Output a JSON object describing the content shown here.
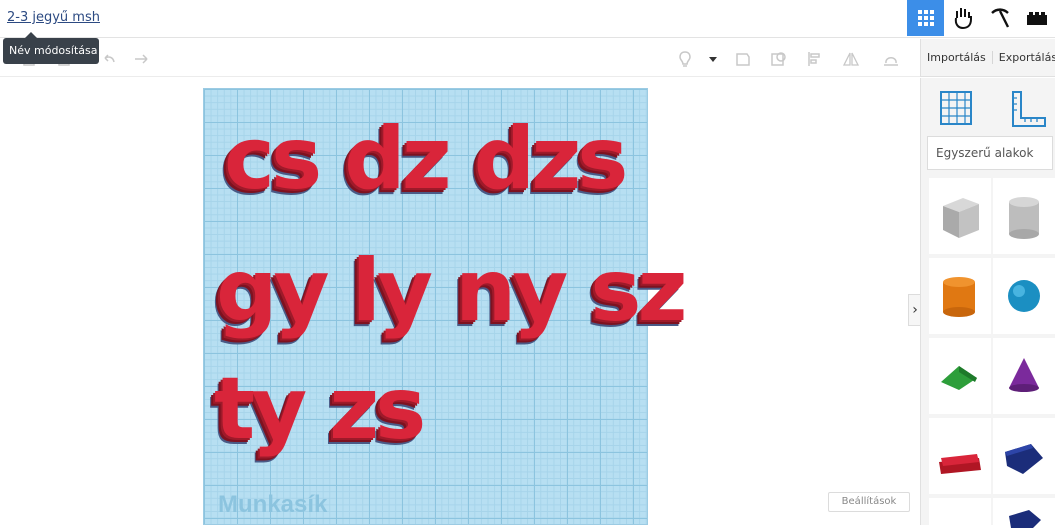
{
  "header": {
    "design_title": "2-3 jegyű msh",
    "tooltip": "Név módosítása"
  },
  "top_icons": [
    "grid-view-icon",
    "hand-tinker-icon",
    "pickaxe-icon",
    "bricks-icon"
  ],
  "side_header": {
    "import_label": "Importálás",
    "export_label": "Exportálás"
  },
  "workplane": {
    "rows": [
      "cs dz dzs",
      "gy ly ny sz",
      "ty zs"
    ],
    "label": "Munkasík"
  },
  "settings_label": "Beállítások",
  "sidepanel": {
    "category": "Egyszerű alakok",
    "shapes": [
      "box-striped",
      "cylinder-striped",
      "cylinder",
      "sphere",
      "roof",
      "cone",
      "text",
      "polygon"
    ]
  },
  "colors": {
    "accent": "#3c8ee8",
    "letters": "#d9253a",
    "workplane": "#b7dff2"
  }
}
